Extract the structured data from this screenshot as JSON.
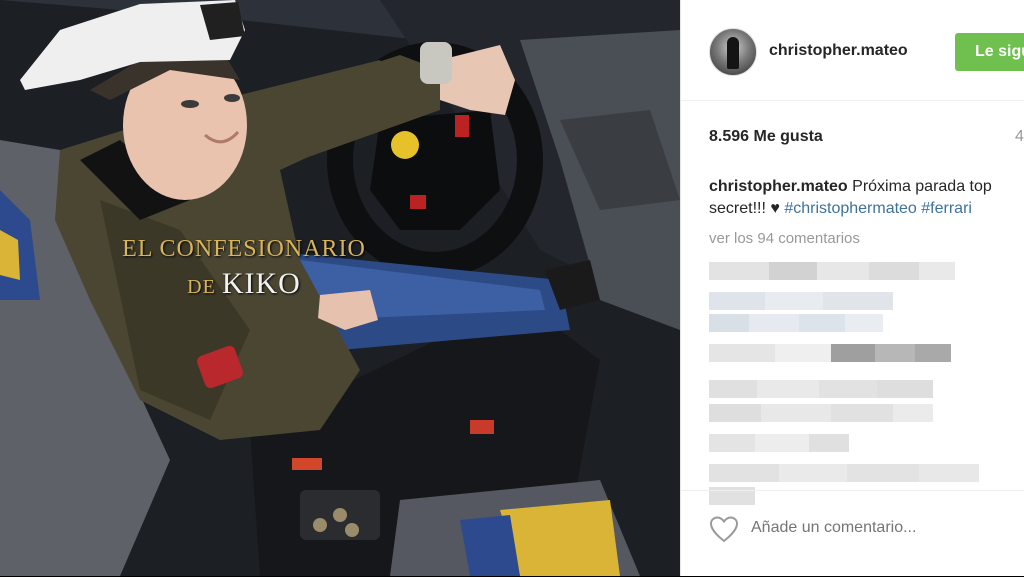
{
  "photo": {
    "alt_icon": "photo-image",
    "watermark": {
      "line1": "EL CONFESIONARIO",
      "de": "DE",
      "kiko": "KIKO"
    }
  },
  "post": {
    "username": "christopher.mateo",
    "follow_label": "Le sigue",
    "likes": "8.596 Me gusta",
    "time": "4",
    "caption": {
      "user": "christopher.mateo",
      "text_line1": "Próxima parada top",
      "text_line2_a": "secret!!! ",
      "heart": "♥",
      "hashtag1": "#christophermateo",
      "hashtag2": "#ferrari"
    },
    "view_all": "ver los 94 comentarios",
    "add_comment_placeholder": "Añade un comentario..."
  },
  "colors": {
    "follow_green": "#70c050",
    "link_blue": "#3f729b",
    "muted": "#999999",
    "watermark_gold": "#d8b45a"
  }
}
